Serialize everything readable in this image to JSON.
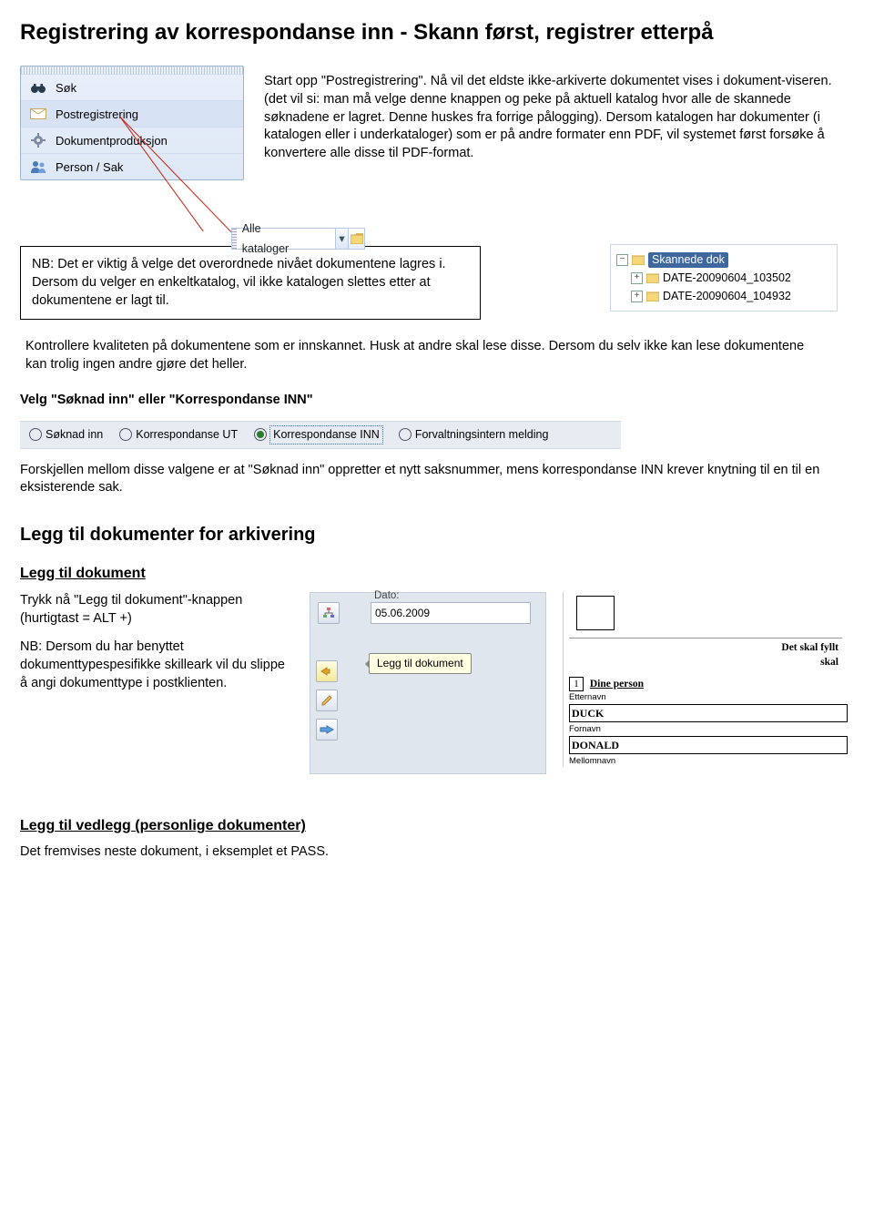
{
  "title": "Registrering av korrespondanse inn - Skann først, registrer etterpå",
  "intro": "Start opp \"Postregistrering\". Nå vil det eldste ikke-arkiverte dokumentet vises i dokument-viseren. (det vil si: man må velge denne knappen og peke på aktuell katalog hvor alle de skannede søknadene er lagret. Denne huskes fra forrige pålogging). Dersom katalogen har dokumenter (i katalogen eller i underkataloger) som er på andre formater enn PDF, vil systemet først forsøke å konvertere alle disse til PDF-format.",
  "sidebar": {
    "items": [
      {
        "label": "Søk"
      },
      {
        "label": "Postregistrering"
      },
      {
        "label": "Dokumentproduksjon"
      },
      {
        "label": "Person / Sak"
      }
    ],
    "dropdown": {
      "label": "Alle kataloger"
    }
  },
  "nb_box": "NB: Det er viktig å velge det overordnede nivået dokumentene lagres i. Dersom du velger en enkeltkatalog, vil ikke katalogen slettes etter at dokumentene er lagt til.",
  "tree": {
    "root": "Skannede dok",
    "children": [
      "DATE-20090604_103502",
      "DATE-20090604_104932"
    ]
  },
  "kvalitet_text": "Kontrollere kvaliteten på dokumentene som er innskannet. Husk at andre skal lese disse. Dersom du selv ikke kan lese dokumentene kan trolig ingen andre gjøre det heller.",
  "velg_heading": "Velg \"Søknad inn\" eller \"Korrespondanse INN\"",
  "radio_options": [
    {
      "label": "Søknad inn",
      "selected": false
    },
    {
      "label": "Korrespondanse UT",
      "selected": false
    },
    {
      "label": "Korrespondanse INN",
      "selected": true
    },
    {
      "label": "Forvaltningsintern melding",
      "selected": false
    }
  ],
  "forskjell_text": "Forskjellen mellom disse valgene er at \"Søknad inn\" oppretter et nytt saksnummer, mens korrespondanse INN krever knytning til en til en eksisterende sak.",
  "section2_title": "Legg til dokumenter for arkivering",
  "section2_sub": "Legg til dokument",
  "add_doc_1": "Trykk nå \"Legg til dokument\"-knappen (hurtigtast = ALT +)",
  "add_doc_2": "NB: Dersom du har benyttet dokumenttypespesifikke skilleark vil du slippe å angi dokumenttype i postklienten.",
  "dato_widget": {
    "label": "Dato:",
    "value": "05.06.2009",
    "tooltip": "Legg til dokument"
  },
  "form_preview": {
    "heading1": "Det skal fyllt",
    "heading1b": "skal",
    "section": "Dine person",
    "label1": "Etternavn",
    "val1": "DUCK",
    "label2": "Fornavn",
    "val2": "DONALD",
    "label3": "Mellomnavn"
  },
  "vedlegg_sub": "Legg til vedlegg (personlige dokumenter)",
  "vedlegg_text": "Det fremvises neste dokument, i eksemplet et PASS."
}
